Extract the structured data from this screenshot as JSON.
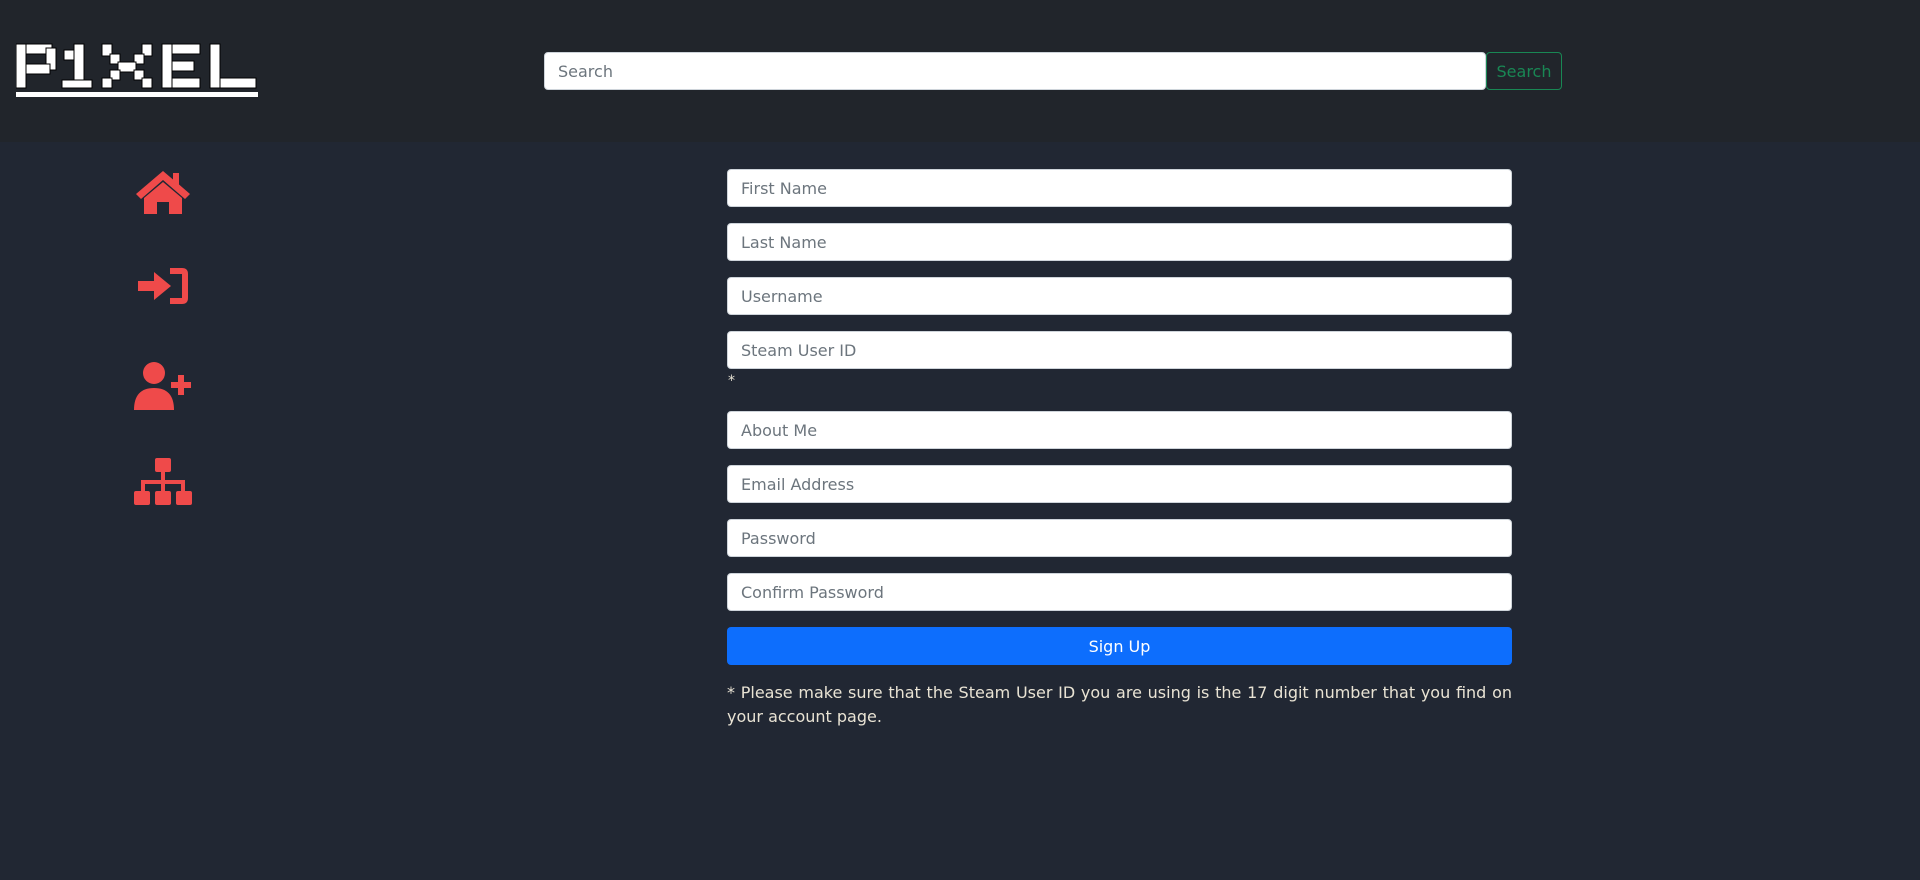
{
  "brand": {
    "logo_text": "P1XEL"
  },
  "header": {
    "search": {
      "placeholder": "Search",
      "button_label": "Search"
    }
  },
  "sidebar": {
    "items": [
      {
        "icon": "home-icon"
      },
      {
        "icon": "sign-in-icon"
      },
      {
        "icon": "user-plus-icon"
      },
      {
        "icon": "sitemap-icon"
      }
    ]
  },
  "form": {
    "fields": {
      "first_name": "First Name",
      "last_name": "Last Name",
      "username": "Username",
      "steam_user_id": "Steam User ID",
      "about_me": "About Me",
      "email": "Email Address",
      "password": "Password",
      "confirm_password": "Confirm Password"
    },
    "steam_id_marker": "*",
    "submit_label": "Sign Up",
    "note": "* Please make sure that the Steam User ID you are using is the 17 digit number that you find on your account page."
  },
  "colors": {
    "header_bg": "#21252b",
    "page_bg": "#212733",
    "icon_accent": "#ef4a4a",
    "primary_button": "#0d6efd",
    "search_button": "#198754",
    "note_text": "#e9e3d4"
  }
}
